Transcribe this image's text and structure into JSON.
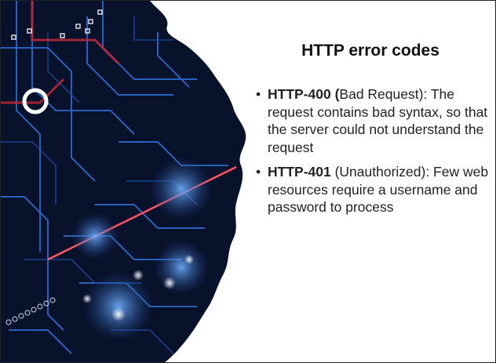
{
  "slide": {
    "title": "HTTP error codes",
    "bullets": [
      {
        "code": "HTTP-400",
        "paren_open": " (",
        "rest": "Bad Request): The request contains bad syntax, so that the server could not understand the request"
      },
      {
        "code": "HTTP-401",
        "paren_open": "",
        "rest": " (Unauthorized): Few web resources require a username and password to process"
      }
    ],
    "bullet_glyph": "•"
  },
  "colors": {
    "circuit_bg": "#0a1530",
    "trace_blue": "#2f6fd6",
    "trace_red": "#c0283a",
    "glow_blue": "#5aa0ff"
  }
}
